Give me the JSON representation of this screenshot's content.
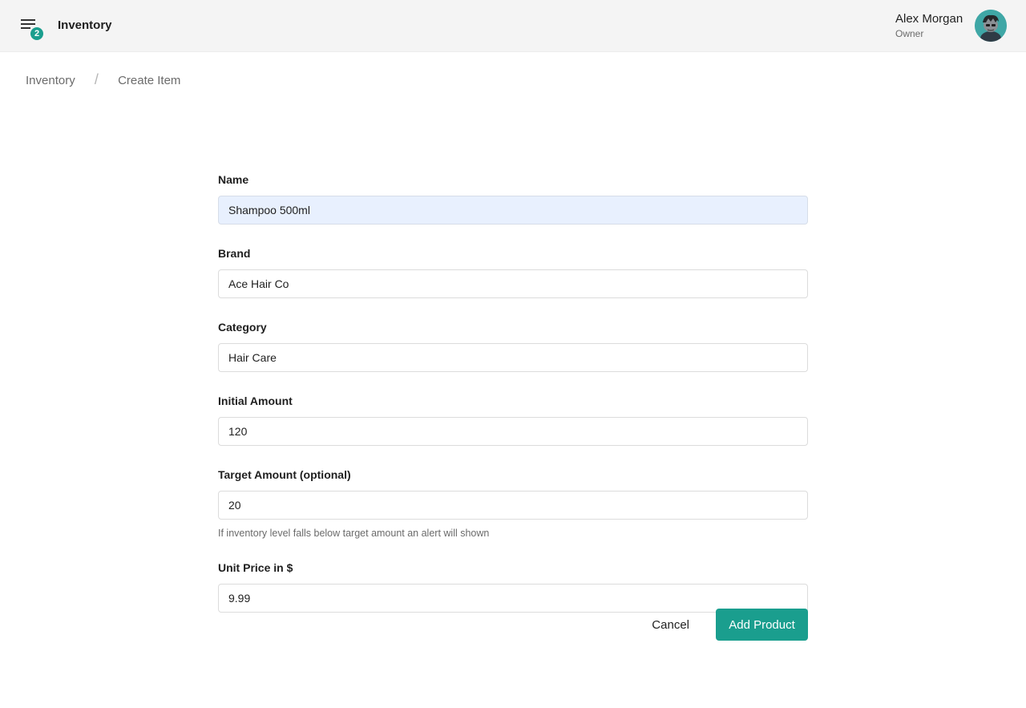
{
  "header": {
    "app_title": "Inventory",
    "menu_badge": "2",
    "user": {
      "name": "Alex Morgan",
      "role": "Owner"
    }
  },
  "breadcrumb": {
    "items": [
      "Inventory",
      "Create Item"
    ],
    "separator": "/"
  },
  "form": {
    "fields": [
      {
        "label": "Name",
        "value": "Shampoo 500ml"
      },
      {
        "label": "Brand",
        "value": "Ace Hair Co"
      },
      {
        "label": "Category",
        "value": "Hair Care"
      },
      {
        "label": "Initial Amount",
        "value": "120"
      },
      {
        "label": "Target Amount (optional)",
        "value": "20",
        "help": "If inventory level falls below target amount an alert will shown"
      },
      {
        "label": "Unit Price in $",
        "value": "9.99"
      }
    ],
    "cancel_label": "Cancel",
    "submit_label": "Add Product"
  },
  "colors": {
    "accent": "#1a9e8e",
    "topbar_bg": "#f4f4f4",
    "autofill_bg": "#e8f0fe"
  }
}
